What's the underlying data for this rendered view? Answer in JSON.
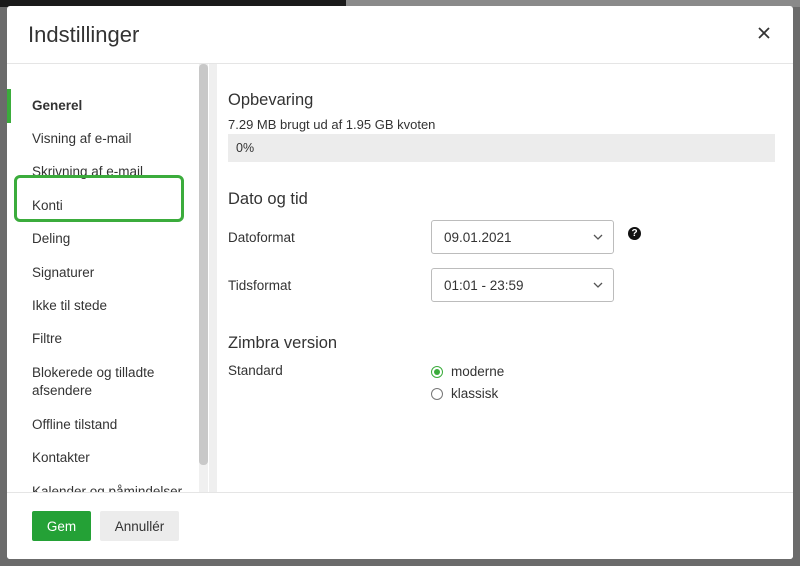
{
  "dialog": {
    "title": "Indstillinger",
    "close_icon": "close-icon"
  },
  "sidebar": {
    "items": [
      {
        "label": "Generel",
        "active": true
      },
      {
        "label": "Visning af e-mail"
      },
      {
        "label": "Skrivning af e-mail"
      },
      {
        "label": "Konti",
        "highlighted": true
      },
      {
        "label": "Deling"
      },
      {
        "label": "Signaturer"
      },
      {
        "label": "Ikke til stede"
      },
      {
        "label": "Filtre"
      },
      {
        "label": "Blokerede og tilladte afsendere"
      },
      {
        "label": "Offline tilstand"
      },
      {
        "label": "Kontakter"
      },
      {
        "label": "Kalender og påmindelser"
      }
    ]
  },
  "storage": {
    "title": "Opbevaring",
    "usage_text": "7.29 MB brugt ud af 1.95 GB kvoten",
    "percent_label": "0%",
    "percent": 0
  },
  "datetime": {
    "title": "Dato og tid",
    "date_label": "Datoformat",
    "date_value": "09.01.2021",
    "time_label": "Tidsformat",
    "time_value": "01:01 - 23:59",
    "help_icon": "question-circle-icon"
  },
  "zimbra": {
    "title": "Zimbra version",
    "label": "Standard",
    "options": [
      {
        "label": "moderne",
        "checked": true
      },
      {
        "label": "klassisk",
        "checked": false
      }
    ]
  },
  "footer": {
    "save_label": "Gem",
    "cancel_label": "Annullér"
  },
  "colors": {
    "accent": "#3bac3c",
    "primary_button": "#24a136"
  }
}
